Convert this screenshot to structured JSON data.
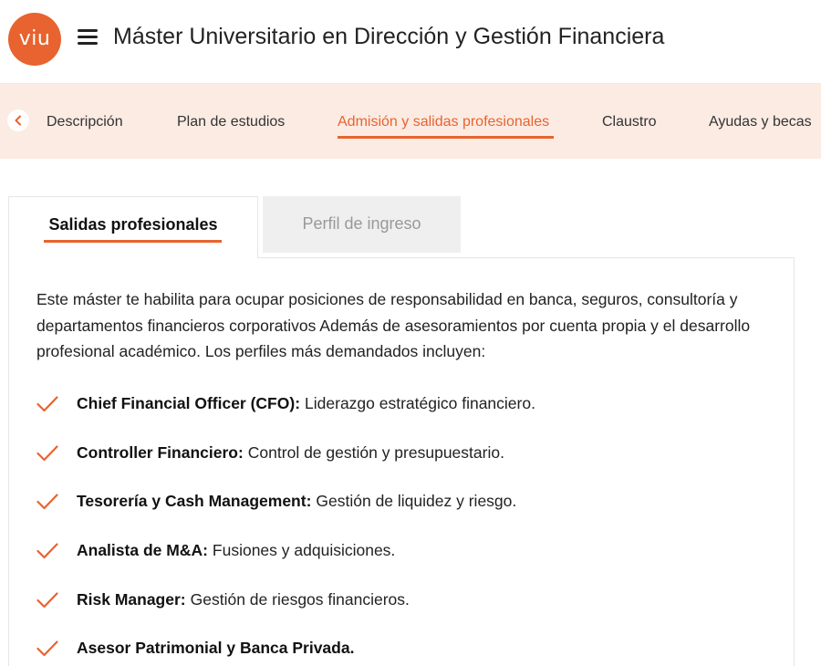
{
  "header": {
    "logo_text": "viu",
    "title": "Máster Universitario en Dirección y Gestión Financiera"
  },
  "nav": {
    "tabs": [
      {
        "label": "Descripción"
      },
      {
        "label": "Plan de estudios"
      },
      {
        "label": "Admisión y salidas profesionales",
        "active": true
      },
      {
        "label": "Claustro"
      },
      {
        "label": "Ayudas y becas"
      }
    ]
  },
  "content_tabs": [
    {
      "label": "Salidas profesionales",
      "active": true
    },
    {
      "label": "Perfil de ingreso"
    }
  ],
  "panel": {
    "intro": "Este máster te habilita para ocupar posiciones de responsabilidad en banca, seguros, consultoría y departamentos financieros corporativos Además de asesoramientos por cuenta propia y el desarrollo profesional académico. Los perfiles más demandados incluyen:",
    "profiles": [
      {
        "title": "Chief Financial Officer (CFO):",
        "desc": "Liderazgo estratégico financiero."
      },
      {
        "title": "Controller Financiero:",
        "desc": "Control de gestión y presupuestario."
      },
      {
        "title": "Tesorería y Cash Management:",
        "desc": "Gestión de liquidez y riesgo."
      },
      {
        "title": "Analista de M&A:",
        "desc": "Fusiones y adquisiciones."
      },
      {
        "title": "Risk Manager:",
        "desc": "Gestión de riesgos financieros."
      },
      {
        "title": "Asesor Patrimonial y Banca Privada.",
        "desc": ""
      }
    ]
  },
  "colors": {
    "accent": "#e8632f",
    "nav_background": "#fcebe3",
    "inactive_tab": "#efefef"
  },
  "icons": {
    "menu": "hamburger-icon",
    "nav_prev": "chevron-left-icon",
    "list_marker": "check-icon"
  }
}
